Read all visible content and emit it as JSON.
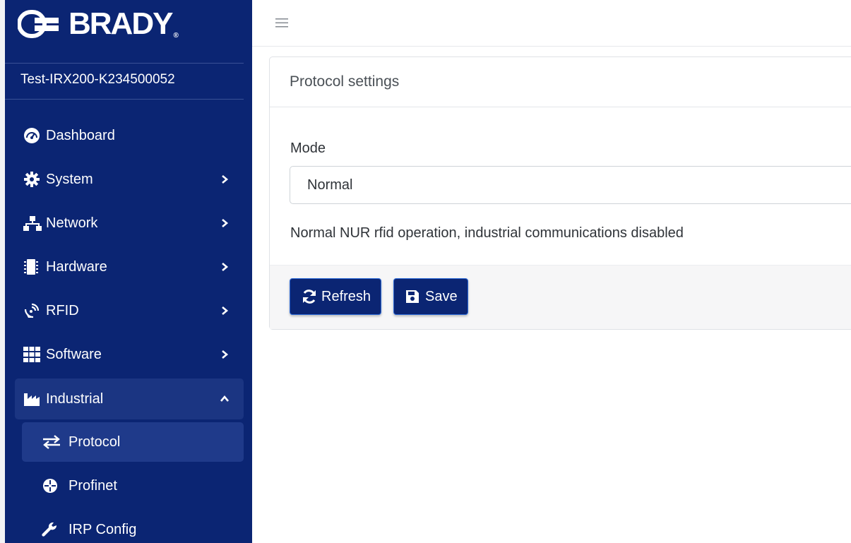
{
  "brand": {
    "name": "BRADY",
    "registered": "®"
  },
  "device": {
    "name": "Test-IRX200-K234500052"
  },
  "sidebar": {
    "items": [
      {
        "label": "Dashboard"
      },
      {
        "label": "System"
      },
      {
        "label": "Network"
      },
      {
        "label": "Hardware"
      },
      {
        "label": "RFID"
      },
      {
        "label": "Software"
      },
      {
        "label": "Industrial"
      }
    ],
    "subitems": [
      {
        "label": "Protocol"
      },
      {
        "label": "Profinet"
      },
      {
        "label": "IRP Config"
      }
    ]
  },
  "card": {
    "title": "Protocol settings",
    "mode_label": "Mode",
    "mode_value": "Normal",
    "help_text": "Normal NUR rfid operation, industrial communications disabled"
  },
  "buttons": {
    "refresh": "Refresh",
    "save": "Save"
  },
  "colors": {
    "sidebar": "#0b2573",
    "button": "#0b2573",
    "button_border": "#2d6ad8"
  }
}
